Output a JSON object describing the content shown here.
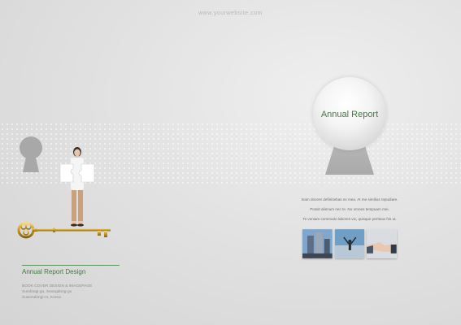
{
  "header": {
    "url": "www.yourwebsite.com"
  },
  "cover": {
    "title": "Annual Report"
  },
  "intro_lines": [
    "Inam docere definitiebas ex mea. At me similius repudiare.",
    "Possit alienum nec te. No omnes tempuam mei.",
    "Te veniam commodo labores vix, quisque pertinax his ut."
  ],
  "footer": {
    "title": "Annual Report Design",
    "subtitle": "BOOK COVER DESIGN & IMAGEPAGE",
    "lines": [
      "Sundongi-gu, Seongdong-gu",
      "Suwondongi-ro, Korea"
    ]
  },
  "thumbnails": [
    {
      "name": "city-buildings-photo"
    },
    {
      "name": "man-arms-up-photo"
    },
    {
      "name": "handshake-photo"
    }
  ],
  "colors": {
    "accent": "#3f7a43",
    "background": "#dcdcdc"
  }
}
